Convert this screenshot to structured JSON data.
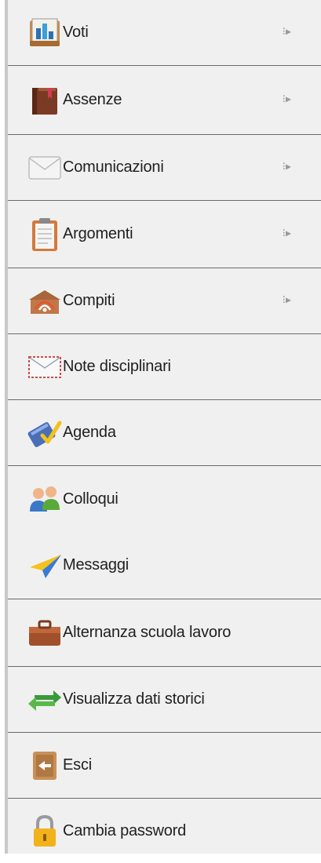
{
  "menu": {
    "items": [
      {
        "label": "Voti",
        "icon": "grades-book-icon",
        "submenu": true
      },
      {
        "label": "Assenze",
        "icon": "absences-book-icon",
        "submenu": true
      },
      {
        "label": "Comunicazioni",
        "icon": "envelope-icon",
        "submenu": true
      },
      {
        "label": "Argomenti",
        "icon": "clipboard-icon",
        "submenu": true
      },
      {
        "label": "Compiti",
        "icon": "homework-wifi-icon",
        "submenu": true
      },
      {
        "label": "Note disciplinari",
        "icon": "mail-letter-icon",
        "submenu": false
      },
      {
        "label": "Agenda",
        "icon": "notebook-check-icon",
        "submenu": false
      },
      {
        "label": "Colloqui",
        "icon": "people-icon",
        "submenu": false
      },
      {
        "label": "Messaggi",
        "icon": "paper-plane-icon",
        "submenu": false
      },
      {
        "label": "Alternanza scuola lavoro",
        "icon": "briefcase-icon",
        "submenu": false
      },
      {
        "label": "Visualizza dati storici",
        "icon": "swap-arrows-icon",
        "submenu": false
      },
      {
        "label": "Esci",
        "icon": "exit-door-icon",
        "submenu": false
      },
      {
        "label": "Cambia password",
        "icon": "lock-icon",
        "submenu": false
      }
    ],
    "submenu_glyph": "⁝▸"
  }
}
